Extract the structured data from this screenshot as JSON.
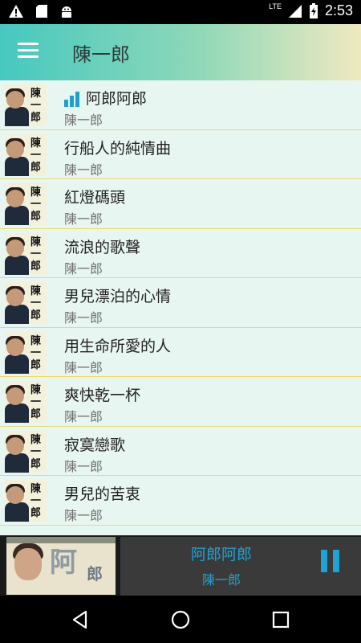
{
  "status_bar": {
    "time": "2:53",
    "network": "LTE",
    "icons": [
      "warning-icon",
      "sd-card-icon",
      "android-icon",
      "signal-icon",
      "battery-charging-icon"
    ]
  },
  "app_bar": {
    "title": "陳一郎",
    "menu_icon": "menu-icon"
  },
  "songs": [
    {
      "title": "阿郎阿郎",
      "artist": "陳一郎",
      "playing": true
    },
    {
      "title": "行船人的純情曲",
      "artist": "陳一郎"
    },
    {
      "title": "紅燈碼頭",
      "artist": "陳一郎"
    },
    {
      "title": "流浪的歌聲",
      "artist": "陳一郎"
    },
    {
      "title": "男兒漂泊的心情",
      "artist": "陳一郎"
    },
    {
      "title": "用生命所愛的人",
      "artist": "陳一郎"
    },
    {
      "title": "爽快乾一杯",
      "artist": "陳一郎"
    },
    {
      "title": "寂寞戀歌",
      "artist": "陳一郎"
    },
    {
      "title": "男兒的苦衷",
      "artist": "陳一郎"
    }
  ],
  "now_playing": {
    "title": "阿郎阿郎",
    "artist": "陳一郎",
    "pause_icon": "pause-icon"
  },
  "nav_bar": {
    "icons": [
      "back-icon",
      "home-icon",
      "recents-icon"
    ]
  },
  "colors": {
    "accent": "#1fa3d4",
    "list_bg": "#e8f6f1",
    "divider": "#ecd86e"
  }
}
